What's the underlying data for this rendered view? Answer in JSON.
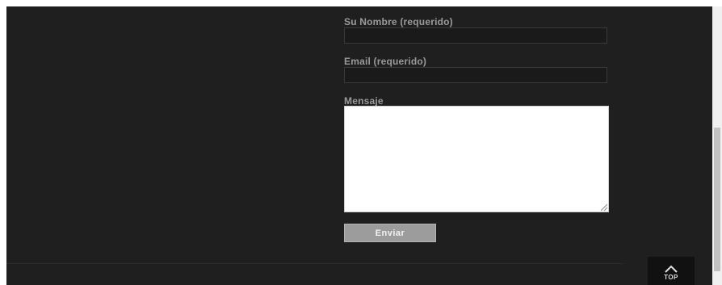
{
  "form": {
    "name_label": "Su Nombre (requerido)",
    "name_value": "",
    "email_label": "Email (requerido)",
    "email_value": "",
    "message_label": "Mensaje",
    "message_value": "",
    "submit_label": "Enviar"
  },
  "footer": {
    "top_label": "TOP",
    "top_icon": "chevron-up-icon"
  },
  "colors": {
    "page_background": "#1f1f1f",
    "label_color": "#9a9a9a",
    "button_background": "#9c9c9c"
  }
}
